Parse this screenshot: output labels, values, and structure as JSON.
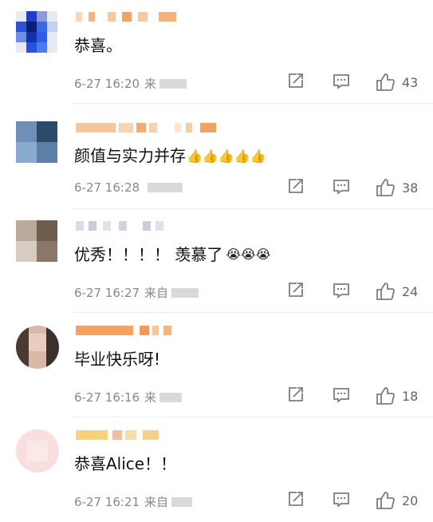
{
  "comments": [
    {
      "content": "恭喜。",
      "time": "6-27 16:20",
      "source": "来",
      "likes": "43"
    },
    {
      "content": "颜值与实力并存",
      "emoji": "👍👍👍👍👍",
      "time": "6-27 16:28",
      "source": "",
      "likes": "38"
    },
    {
      "content": "优秀！！！！ 羡慕了",
      "emoji": "😭😭😭",
      "time": "6-27 16:27",
      "source": "来自",
      "likes": "24"
    },
    {
      "content": "毕业快乐呀!",
      "time": "6-27 16:16",
      "source": "来",
      "likes": "18"
    },
    {
      "content": "恭喜Alice！！",
      "time": "6-27 16:21",
      "source": "来自",
      "likes": "20"
    }
  ],
  "icons": {
    "share": "share-icon",
    "reply": "reply-icon",
    "like": "thumbs-up-icon"
  },
  "colors": {
    "text": "#111111",
    "meta": "#888888",
    "icon": "#7d7d7d",
    "divider": "#ececec",
    "username_blur": "#f6a96b"
  }
}
